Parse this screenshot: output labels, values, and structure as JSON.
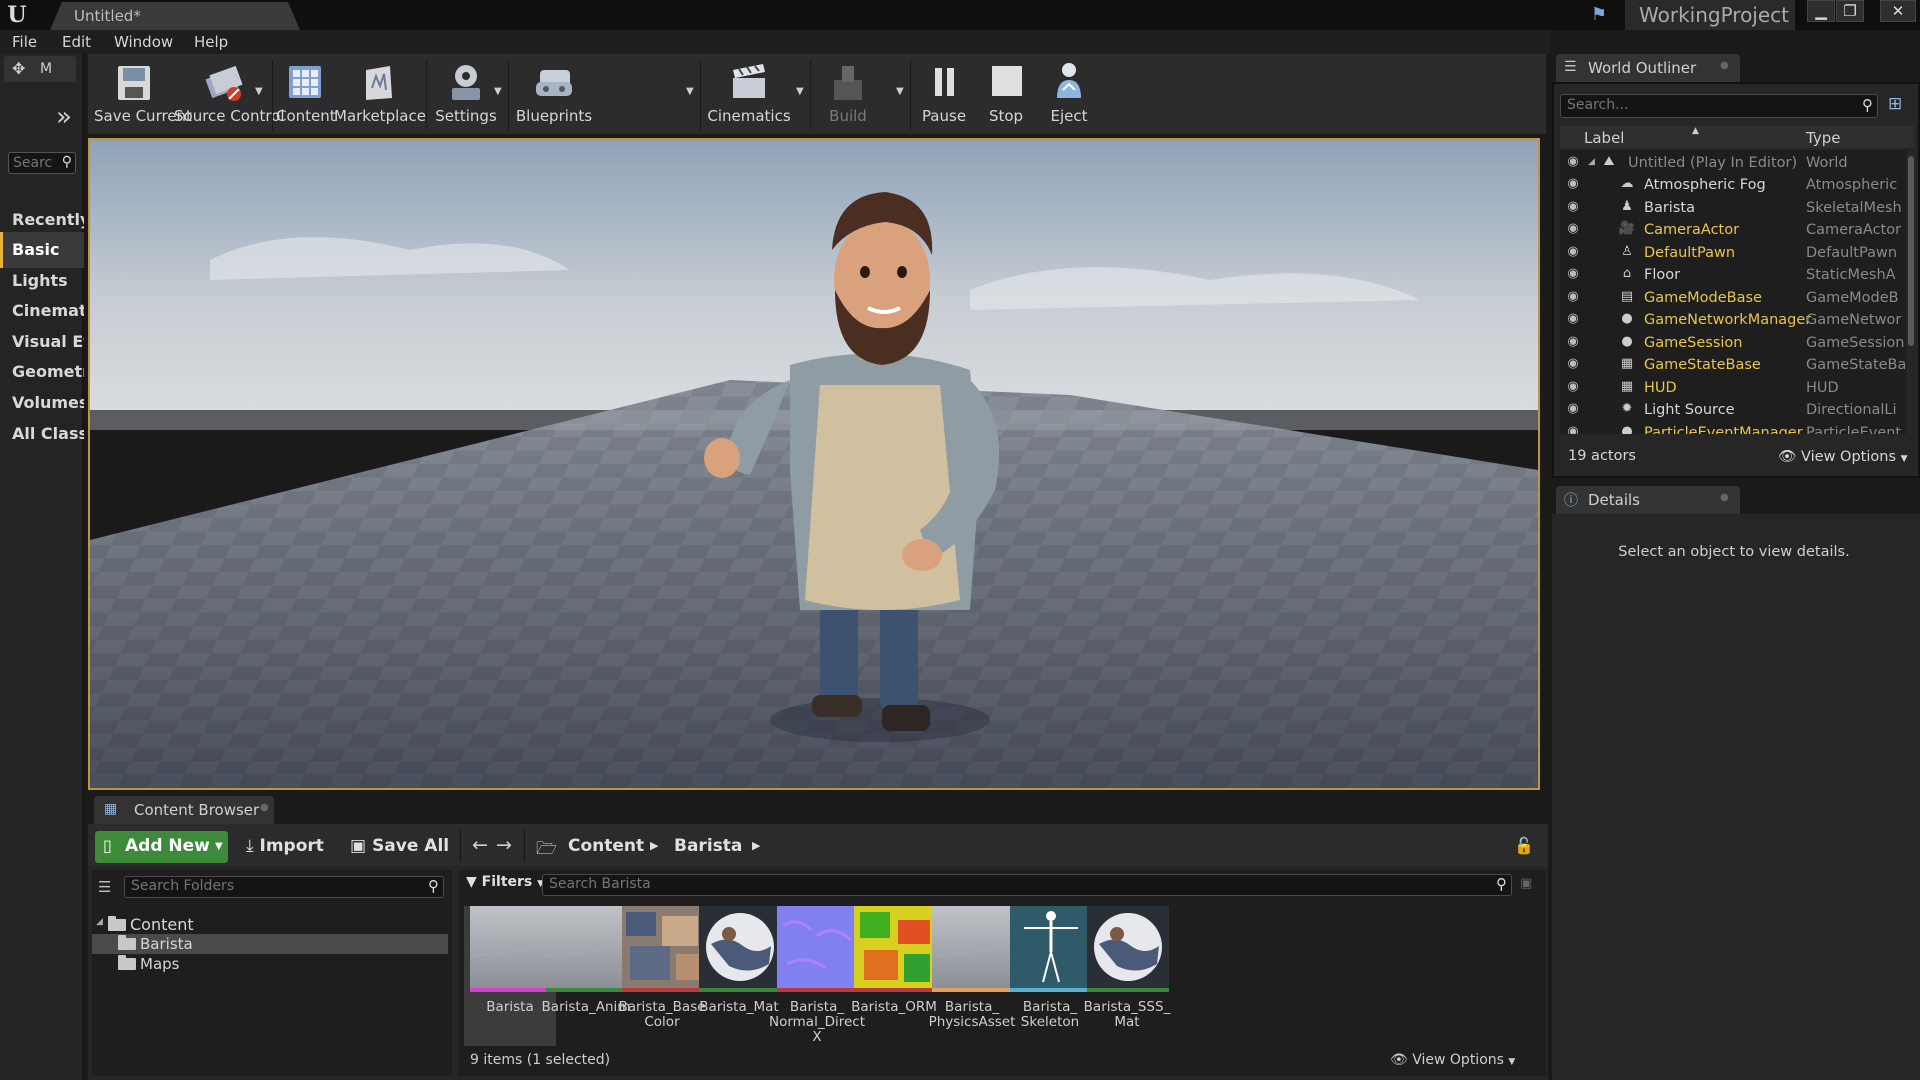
{
  "window": {
    "tab_title": "Untitled*",
    "project_name": "WorkingProject",
    "minimize": "▁",
    "maximize": "❐",
    "close": "✕"
  },
  "menu": [
    "File",
    "Edit",
    "Window",
    "Help"
  ],
  "modes": {
    "tab_label": "M",
    "search_placeholder": "Search",
    "items": [
      "Recently",
      "Basic",
      "Lights",
      "Cinematic",
      "Visual Eff",
      "Geometry",
      "Volumes",
      "All Classe"
    ],
    "active_index": 1
  },
  "toolbar": {
    "buttons": [
      {
        "label": "Save Current",
        "icon": "save-icon"
      },
      {
        "label": "Source Control",
        "icon": "source-control-icon"
      },
      {
        "label": "Content",
        "icon": "content-icon"
      },
      {
        "label": "Marketplace",
        "icon": "marketplace-icon"
      },
      {
        "label": "Settings",
        "icon": "settings-icon"
      },
      {
        "label": "Blueprints",
        "icon": "blueprints-icon"
      },
      {
        "label": "Cinematics",
        "icon": "cinematics-icon"
      },
      {
        "label": "Build",
        "icon": "build-icon",
        "disabled": true
      },
      {
        "label": "Pause",
        "icon": "pause-icon"
      },
      {
        "label": "Stop",
        "icon": "stop-icon"
      },
      {
        "label": "Eject",
        "icon": "eject-icon"
      }
    ]
  },
  "content_browser": {
    "tab_label": "Content Browser",
    "add_new": "Add New",
    "import": "Import",
    "save_all": "Save All",
    "breadcrumbs": [
      "Content",
      "Barista"
    ],
    "folder_search_placeholder": "Search Folders",
    "filters": "Filters",
    "asset_search_placeholder": "Search Barista",
    "tree": [
      {
        "label": "Content",
        "level": 0
      },
      {
        "label": "Barista",
        "level": 1,
        "selected": true
      },
      {
        "label": "Maps",
        "level": 1
      }
    ],
    "assets": [
      {
        "name": "Barista",
        "stripe": "#d43fd4",
        "thumb": "mesh",
        "selected": true
      },
      {
        "name": "Barista_Anim",
        "stripe": "#3a8a3a",
        "thumb": "mesh"
      },
      {
        "name": "Barista_Base Color",
        "stripe": "#b83a3a",
        "thumb": "texture-base"
      },
      {
        "name": "Barista_Mat",
        "stripe": "#3a8a3a",
        "thumb": "sphere"
      },
      {
        "name": "Barista_ Normal_Direct X",
        "stripe": "#b83a3a",
        "thumb": "texture-normal"
      },
      {
        "name": "Barista_ORM",
        "stripe": "#b83a3a",
        "thumb": "texture-orm"
      },
      {
        "name": "Barista_ PhysicsAsset",
        "stripe": "#e0a060",
        "thumb": "mesh"
      },
      {
        "name": "Barista_ Skeleton",
        "stripe": "#5ab0d0",
        "thumb": "skeleton"
      },
      {
        "name": "Barista_SSS_ Mat",
        "stripe": "#3a8a3a",
        "thumb": "sphere"
      }
    ],
    "status": "9 items (1 selected)",
    "view_options": "View Options"
  },
  "world_outliner": {
    "tab_label": "World Outliner",
    "search_placeholder": "Search...",
    "col_label": "Label",
    "col_type": "Type",
    "root": {
      "label": "Untitled (Play In Editor)",
      "type": "World"
    },
    "actors": [
      {
        "label": "Atmospheric Fog",
        "type": "Atmospheric",
        "color": "#d6d6d6"
      },
      {
        "label": "Barista",
        "type": "SkeletalMesh",
        "color": "#d6d6d6"
      },
      {
        "label": "CameraActor",
        "type": "CameraActor",
        "color": "#e8c64a"
      },
      {
        "label": "DefaultPawn",
        "type": "DefaultPawn",
        "color": "#e8c64a"
      },
      {
        "label": "Floor",
        "type": "StaticMeshA",
        "color": "#d6d6d6"
      },
      {
        "label": "GameModeBase",
        "type": "GameModeB",
        "color": "#e8c64a"
      },
      {
        "label": "GameNetworkManager",
        "type": "GameNetwor",
        "color": "#e8c64a"
      },
      {
        "label": "GameSession",
        "type": "GameSession",
        "color": "#e8c64a"
      },
      {
        "label": "GameStateBase",
        "type": "GameStateBa",
        "color": "#e8c64a"
      },
      {
        "label": "HUD",
        "type": "HUD",
        "color": "#e8c64a"
      },
      {
        "label": "Light Source",
        "type": "DirectionalLi",
        "color": "#d6d6d6"
      },
      {
        "label": "ParticleEventManager",
        "type": "ParticleEvent",
        "color": "#e8c64a"
      }
    ],
    "actor_count": "19 actors",
    "view_options": "View Options"
  },
  "details": {
    "tab_label": "Details",
    "empty_message": "Select an object to view details."
  }
}
